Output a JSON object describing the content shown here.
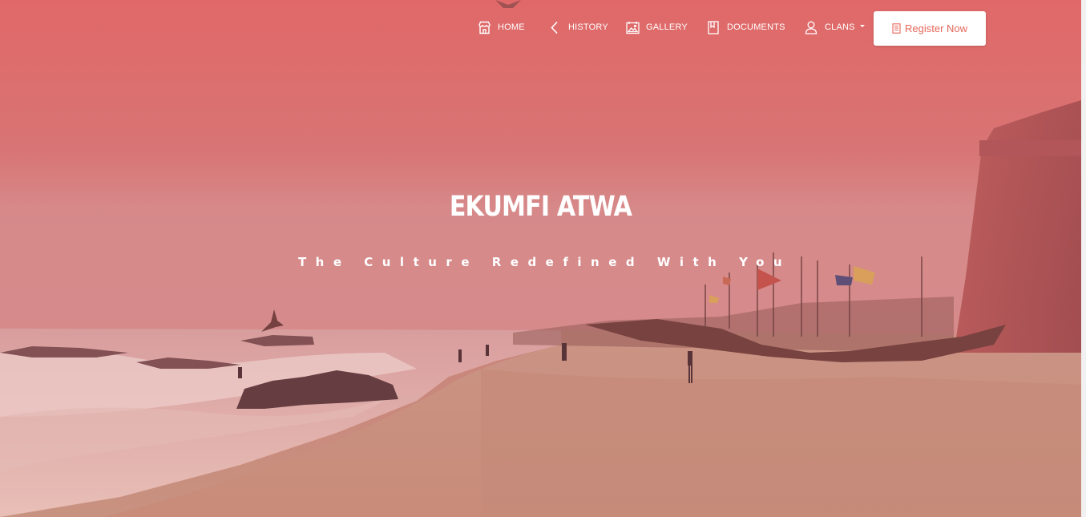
{
  "nav": {
    "items": [
      {
        "label": "HOME",
        "icon": "shop-icon"
      },
      {
        "label": "HISTORY",
        "icon": "chevron-left-icon"
      },
      {
        "label": "GALLERY",
        "icon": "image-icon"
      },
      {
        "label": "DOCUMENTS",
        "icon": "book-icon"
      },
      {
        "label": "CLANS",
        "icon": "user-icon"
      }
    ],
    "register_label": "Register Now",
    "register_icon": "document-icon"
  },
  "hero": {
    "title": "EKUMFI ATWA",
    "tagline": "The Culture Redefined With You"
  },
  "colors": {
    "overlay": "#e06a6a",
    "button_text": "#e5675a",
    "text": "#ffffff"
  }
}
